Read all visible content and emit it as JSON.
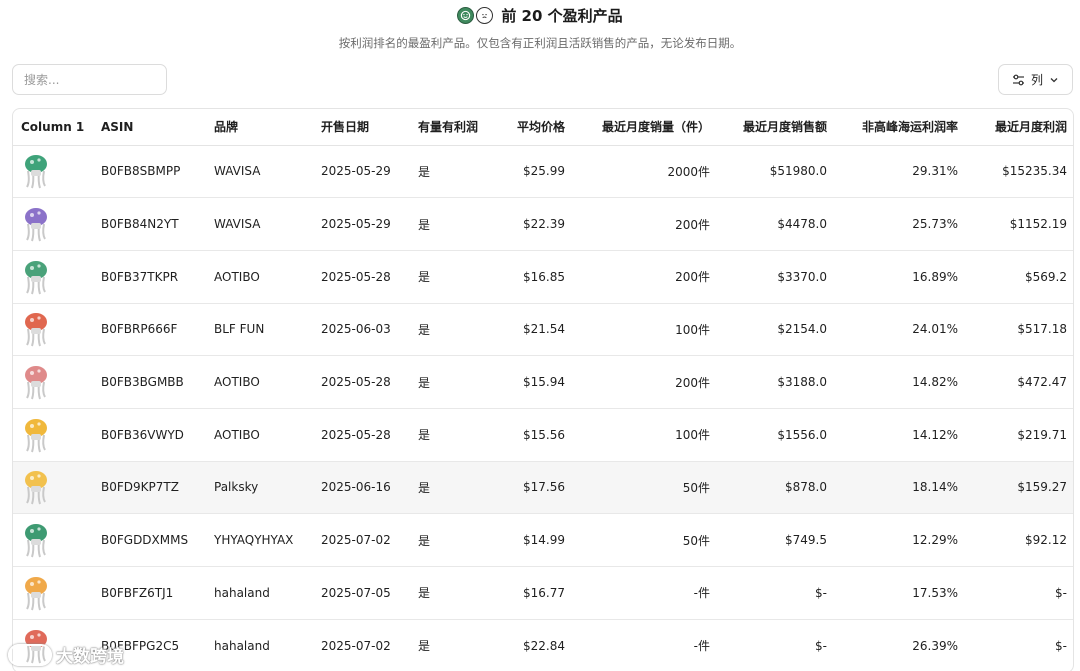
{
  "header": {
    "title": "前 20 个盈利产品",
    "subtitle": "按利润排名的最盈利产品。仅包含有正利润且活跃销售的产品，无论发布日期。"
  },
  "search": {
    "placeholder": "搜索..."
  },
  "columns_button": {
    "label": "列"
  },
  "table": {
    "headers": [
      "Column 1",
      "ASIN",
      "品牌",
      "开售日期",
      "有量有利润",
      "平均价格",
      "最近月度销量（件）",
      "最近月度销售额",
      "非高峰海运利润率",
      "最近月度利润"
    ],
    "rows": [
      {
        "thumb": "green",
        "asin": "B0FB8SBMPP",
        "brand": "WAVISA",
        "date": "2025-05-29",
        "profitable": "是",
        "avg_price": "$25.99",
        "units": "2000件",
        "revenue": "$51980.0",
        "margin": "29.31%",
        "profit": "$15235.34"
      },
      {
        "thumb": "purple",
        "asin": "B0FB84N2YT",
        "brand": "WAVISA",
        "date": "2025-05-29",
        "profitable": "是",
        "avg_price": "$22.39",
        "units": "200件",
        "revenue": "$4478.0",
        "margin": "25.73%",
        "profit": "$1152.19"
      },
      {
        "thumb": "green2",
        "asin": "B0FB37TKPR",
        "brand": "AOTIBO",
        "date": "2025-05-28",
        "profitable": "是",
        "avg_price": "$16.85",
        "units": "200件",
        "revenue": "$3370.0",
        "margin": "16.89%",
        "profit": "$569.2"
      },
      {
        "thumb": "red",
        "asin": "B0FBRP666F",
        "brand": "BLF FUN",
        "date": "2025-06-03",
        "profitable": "是",
        "avg_price": "$21.54",
        "units": "100件",
        "revenue": "$2154.0",
        "margin": "24.01%",
        "profit": "$517.18"
      },
      {
        "thumb": "pink",
        "asin": "B0FB3BGMBB",
        "brand": "AOTIBO",
        "date": "2025-05-28",
        "profitable": "是",
        "avg_price": "$15.94",
        "units": "200件",
        "revenue": "$3188.0",
        "margin": "14.82%",
        "profit": "$472.47"
      },
      {
        "thumb": "yellow",
        "asin": "B0FB36VWYD",
        "brand": "AOTIBO",
        "date": "2025-05-28",
        "profitable": "是",
        "avg_price": "$15.56",
        "units": "100件",
        "revenue": "$1556.0",
        "margin": "14.12%",
        "profit": "$219.71"
      },
      {
        "thumb": "lamp",
        "asin": "B0FD9KP7TZ",
        "brand": "Palksky",
        "date": "2025-06-16",
        "profitable": "是",
        "avg_price": "$17.56",
        "units": "50件",
        "revenue": "$878.0",
        "margin": "18.14%",
        "profit": "$159.27"
      },
      {
        "thumb": "green3",
        "asin": "B0FGDDXMMS",
        "brand": "YHYAQYHYAX",
        "date": "2025-07-02",
        "profitable": "是",
        "avg_price": "$14.99",
        "units": "50件",
        "revenue": "$749.5",
        "margin": "12.29%",
        "profit": "$92.12"
      },
      {
        "thumb": "orange",
        "asin": "B0FBFZ6TJ1",
        "brand": "hahaland",
        "date": "2025-07-05",
        "profitable": "是",
        "avg_price": "$16.77",
        "units": "-件",
        "revenue": "$-",
        "margin": "17.53%",
        "profit": "$-"
      },
      {
        "thumb": "red2",
        "asin": "B0FBFPG2C5",
        "brand": "hahaland",
        "date": "2025-07-02",
        "profitable": "是",
        "avg_price": "$22.84",
        "units": "-件",
        "revenue": "$-",
        "margin": "26.39%",
        "profit": "$-"
      }
    ]
  },
  "thumb_colors": {
    "green": "#3fa37a",
    "purple": "#8b72c9",
    "green2": "#4aa27a",
    "red": "#e0674f",
    "pink": "#df8a8a",
    "yellow": "#f0b83c",
    "lamp": "#f2c14e",
    "green3": "#3e9a72",
    "orange": "#f0a94a",
    "red2": "#e06a5a"
  },
  "watermark": {
    "text": "大数跨境"
  }
}
